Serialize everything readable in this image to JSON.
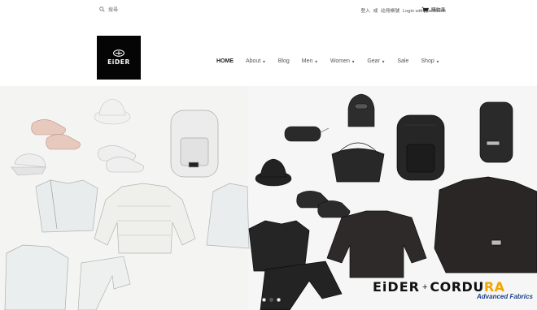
{
  "topbar": {
    "search_placeholder": "搜尋",
    "login": "登入",
    "or": "或",
    "register": "註冊帳號",
    "facebook": "Login with Facebook",
    "cart": "購物車"
  },
  "logo": {
    "wordmark": "EiDER"
  },
  "nav": [
    {
      "label": "HOME",
      "dropdown": false,
      "active": true
    },
    {
      "label": "About",
      "dropdown": true,
      "active": false
    },
    {
      "label": "Blog",
      "dropdown": false,
      "active": false
    },
    {
      "label": "Men",
      "dropdown": true,
      "active": false
    },
    {
      "label": "Women",
      "dropdown": true,
      "active": false
    },
    {
      "label": "Gear",
      "dropdown": true,
      "active": false
    },
    {
      "label": "Sale",
      "dropdown": false,
      "active": false
    },
    {
      "label": "Shop",
      "dropdown": true,
      "active": false
    }
  ],
  "hero": {
    "brand_left": "EiDER",
    "plus": "+",
    "brand_right_a": "CORDU",
    "brand_right_b": "RA",
    "tagline": "Advanced Fabrics",
    "slides": 3,
    "active_slide": 2
  },
  "colors": {
    "accent_yellow": "#f2a400",
    "tagline_blue": "#1a3f8c",
    "logo_bg": "#050505"
  }
}
